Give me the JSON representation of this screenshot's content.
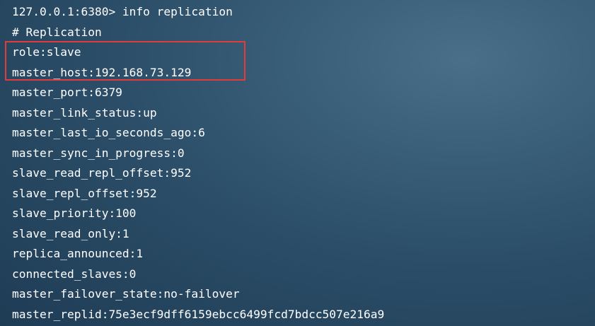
{
  "terminal": {
    "prompt_line": "127.0.0.1:6380> info replication",
    "section_header": "# Replication",
    "lines": [
      "role:slave",
      "master_host:192.168.73.129",
      "master_port:6379",
      "master_link_status:up",
      "master_last_io_seconds_ago:6",
      "master_sync_in_progress:0",
      "slave_read_repl_offset:952",
      "slave_repl_offset:952",
      "slave_priority:100",
      "slave_read_only:1",
      "replica_announced:1",
      "connected_slaves:0",
      "master_failover_state:no-failover",
      "master_replid:75e3ecf9dff6159ebcc6499fcd7bdcc507e216a9"
    ]
  },
  "highlight": {
    "color": "#e23b3b"
  },
  "colors": {
    "text": "#ffffff",
    "background": "#2b4d67"
  }
}
